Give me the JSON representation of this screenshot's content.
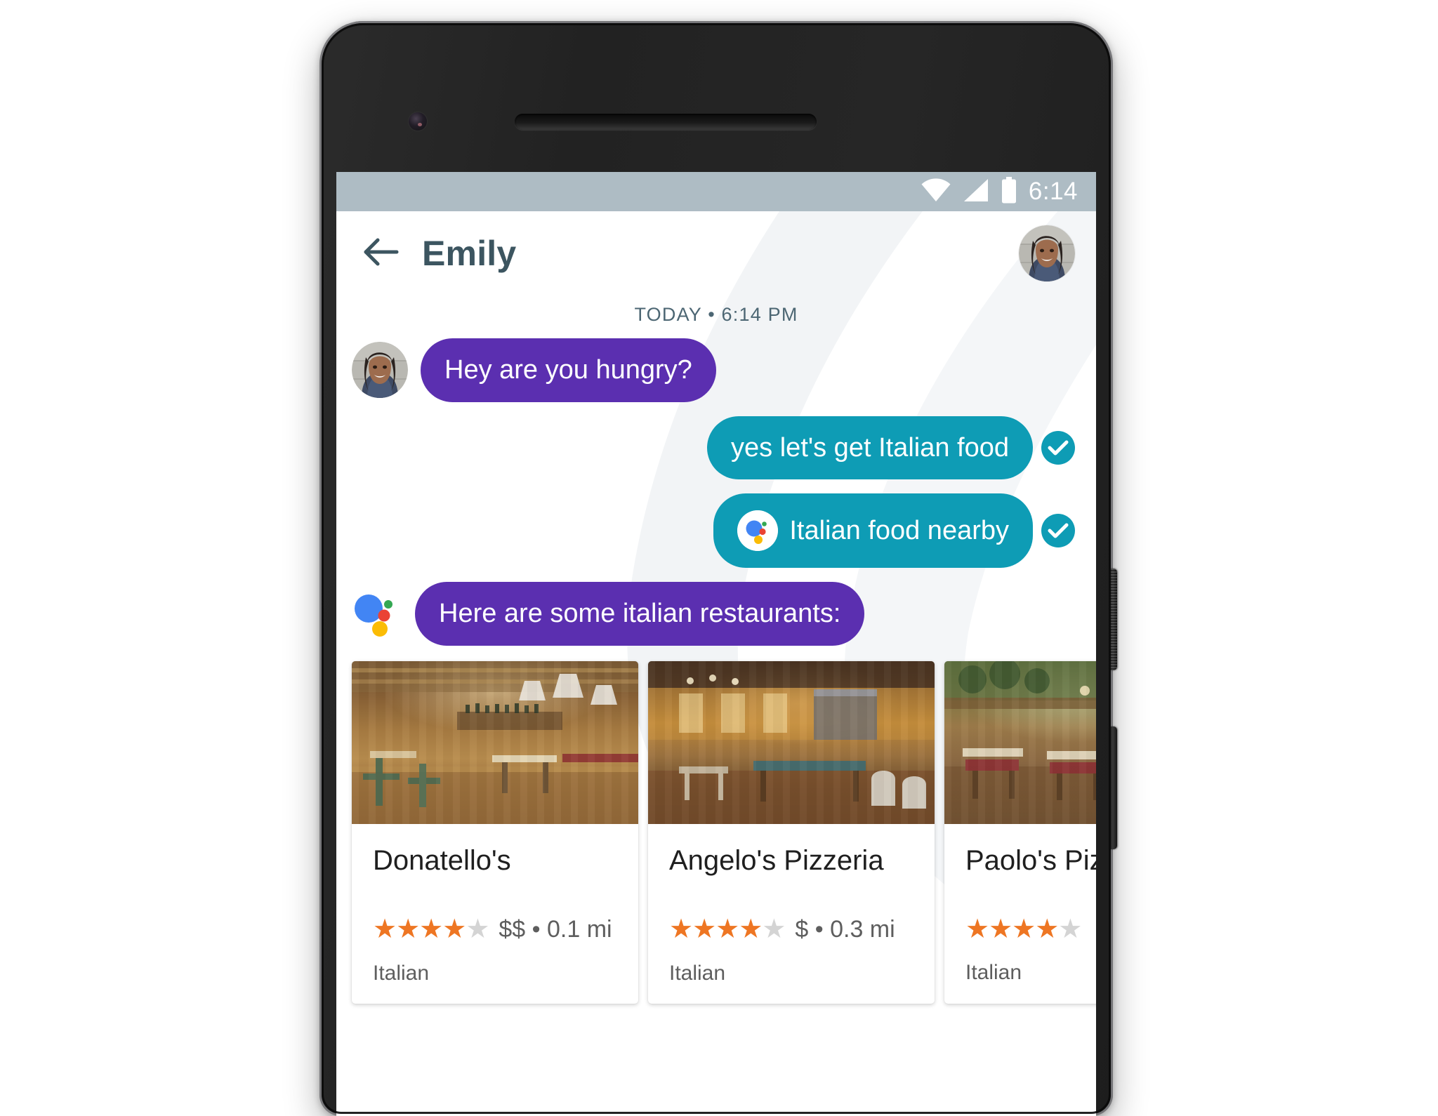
{
  "device": {
    "type": "android-smartphone",
    "camera_icon": "front-camera",
    "earpiece_icon": "earpiece-speaker",
    "power_button_label": "Power",
    "volume_button_label": "Volume"
  },
  "status_bar": {
    "time": "6:14",
    "icons": [
      "wifi-icon",
      "cellular-signal-icon",
      "battery-icon"
    ],
    "background_color": "#aebcc4",
    "foreground_color": "#ffffff"
  },
  "app_bar": {
    "back_icon": "back-arrow-icon",
    "title": "Emily",
    "avatar_name": "Emily",
    "title_color": "#3c5560"
  },
  "conversation": {
    "day_divider": "TODAY • 6:14 PM",
    "colors": {
      "incoming_bubble": "#5b2fb0",
      "outgoing_bubble": "#0e9cb5",
      "sent_check": "#0e9cb5"
    },
    "messages": [
      {
        "id": "msg-1",
        "side": "left",
        "sender": "Emily",
        "text": "Hey are you hungry?",
        "bubble_color": "#5b2fb0",
        "has_avatar": true,
        "has_assistant_logo": false,
        "has_sent_check": false
      },
      {
        "id": "msg-2",
        "side": "right",
        "sender": "You",
        "text": "yes let's get Italian food",
        "bubble_color": "#0e9cb5",
        "has_avatar": false,
        "has_assistant_logo": false,
        "has_sent_check": true
      },
      {
        "id": "msg-3",
        "side": "right",
        "sender": "You",
        "text": "Italian food nearby",
        "bubble_color": "#0e9cb5",
        "has_avatar": false,
        "has_assistant_logo": true,
        "has_sent_check": true
      },
      {
        "id": "msg-4",
        "side": "left",
        "sender": "Google Assistant",
        "text": "Here are some italian restaurants:",
        "bubble_color": "#5b2fb0",
        "has_avatar": false,
        "has_assistant_logo": true,
        "has_sent_check": false
      }
    ]
  },
  "restaurant_cards": [
    {
      "id": "card-donatellos",
      "name": "Donatello's",
      "rating": 4,
      "max_rating": 5,
      "price": "$$",
      "distance": "0.1 mi",
      "meta": "$$ • 0.1 mi",
      "cuisine": "Italian",
      "photo": "restaurant-interior-warm-wood"
    },
    {
      "id": "card-angelos-pizzeria",
      "name": "Angelo's Pizzeria",
      "rating": 4,
      "max_rating": 5,
      "price": "$",
      "distance": "0.3 mi",
      "meta": "$ • 0.3 mi",
      "cuisine": "Italian",
      "photo": "restaurant-interior-amber-dining"
    },
    {
      "id": "card-paolos-pizzeria",
      "name": "Paolo's Pizzeria",
      "rating": 4,
      "max_rating": 5,
      "price": "",
      "distance": "",
      "meta": "",
      "cuisine": "Italian",
      "photo": "restaurant-interior-green-patio",
      "truncated": true
    }
  ],
  "assistant_logo_colors": {
    "blue": "#4285f4",
    "red": "#ea4335",
    "yellow": "#fbbc05",
    "green": "#34a853"
  },
  "star_colors": {
    "filled": "#ee7623",
    "empty": "#d4d4d4"
  }
}
